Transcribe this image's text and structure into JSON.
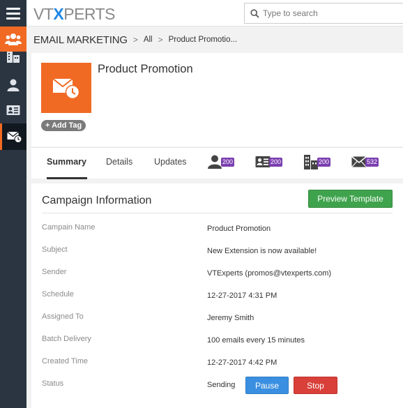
{
  "header": {
    "logo_prefix": "VT",
    "logo_x": "X",
    "logo_suffix": "PERTS",
    "search_placeholder": "Type to search"
  },
  "sidebar": {
    "items": [
      {
        "icon": "users-icon",
        "state": "active"
      },
      {
        "icon": "building-icon",
        "state": "normal"
      },
      {
        "icon": "user-icon",
        "state": "normal"
      },
      {
        "icon": "contact-card-icon",
        "state": "normal"
      },
      {
        "icon": "email-marketing-icon",
        "state": "selected"
      }
    ]
  },
  "breadcrumb": {
    "module": "EMAIL MARKETING",
    "separator": ">",
    "filter": "All",
    "record": "Product Promotio..."
  },
  "record": {
    "title": "Product Promotion",
    "icon": "email-schedule-icon",
    "add_tag": "+ Add Tag"
  },
  "tabs": [
    {
      "label": "Summary",
      "active": true
    },
    {
      "label": "Details",
      "active": false
    },
    {
      "label": "Updates",
      "active": false
    }
  ],
  "related": [
    {
      "icon": "contacts-icon",
      "count": "200"
    },
    {
      "icon": "leads-icon",
      "count": "200"
    },
    {
      "icon": "accounts-icon",
      "count": "200"
    },
    {
      "icon": "emails-icon",
      "count": "532"
    }
  ],
  "panel": {
    "title": "Campaign Information",
    "preview_button": "Preview Template",
    "fields": [
      {
        "label": "Campain Name",
        "value": "Product Promotion"
      },
      {
        "label": "Subject",
        "value": "New Extension is now available!"
      },
      {
        "label": "Sender",
        "value": "VTExperts (promos@vtexperts.com)"
      },
      {
        "label": "Schedule",
        "value": "12-27-2017 4:31 PM"
      },
      {
        "label": "Assigned To",
        "value": "Jeremy Smith"
      },
      {
        "label": "Batch Delivery",
        "value": "100 emails every 15 minutes"
      },
      {
        "label": "Created Time",
        "value": "12-27-2017 4:42 PM"
      },
      {
        "label": "Status",
        "value": "Sending"
      }
    ],
    "pause_button": "Pause",
    "stop_button": "Stop"
  },
  "colors": {
    "accent_orange": "#f06a24",
    "sidebar": "#2a3541",
    "green": "#3fa34d",
    "blue": "#3b8fe0",
    "red": "#d9403a",
    "badge_purple": "#7b3fb0"
  }
}
